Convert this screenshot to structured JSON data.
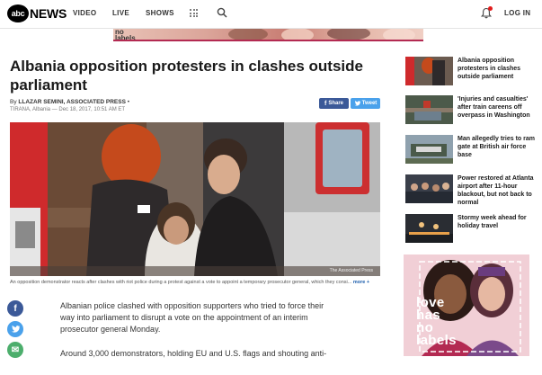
{
  "brand": {
    "logo_mark": "abc",
    "logo_text": "NEWS"
  },
  "nav": {
    "links": [
      "VIDEO",
      "LIVE",
      "SHOWS"
    ],
    "login": "LOG IN",
    "icons": [
      "grid-icon",
      "search-icon",
      "bell-icon"
    ]
  },
  "top_ad": {
    "text_line1": "no",
    "text_line2": "labels"
  },
  "article": {
    "headline": "Albania opposition protesters in clashes outside parliament",
    "byline_prefix": "By ",
    "byline_author": "LLAZAR SEMINI, ASSOCIATED PRESS",
    "byline_suffix": " •",
    "dateline": "TIRANA, Albania — Dec 18, 2017, 10:51 AM ET",
    "share_facebook": "Share",
    "share_twitter": "Tweet",
    "photo_credit": "The Associated Press",
    "caption": "An opposition demonstrator reacts after clashes with riot police during a protest against a vote to appoint a temporary prosecutor general, which they consi...",
    "caption_more": "more +",
    "paragraph_1": "Albanian police clashed with opposition supporters who tried to force their way into parliament to disrupt a vote on the appointment of an interim prosecutor general Monday.",
    "paragraph_2": "Around 3,000 demonstrators, holding EU and U.S. flags and shouting anti-"
  },
  "social": {
    "facebook": "f",
    "twitter": "t",
    "email": "✉"
  },
  "sidebar": {
    "items": [
      {
        "title": "Albania opposition protesters in clashes outside parliament"
      },
      {
        "title": "'Injuries and casualties' after train careens off overpass in Washington"
      },
      {
        "title": "Man allegedly tries to ram gate at British air force base"
      },
      {
        "title": "Power restored at Atlanta airport after 11-hour blackout, but not back to normal"
      },
      {
        "title": "Stormy week ahead for holiday travel"
      }
    ],
    "ad": {
      "line1": "love",
      "line2": "has",
      "line3": "no",
      "line4": "labels"
    }
  },
  "colors": {
    "facebook": "#3b5998",
    "twitter": "#4aa1eb",
    "email": "#4cae6c",
    "notification": "#e21b1b",
    "link": "#1e5fad"
  }
}
